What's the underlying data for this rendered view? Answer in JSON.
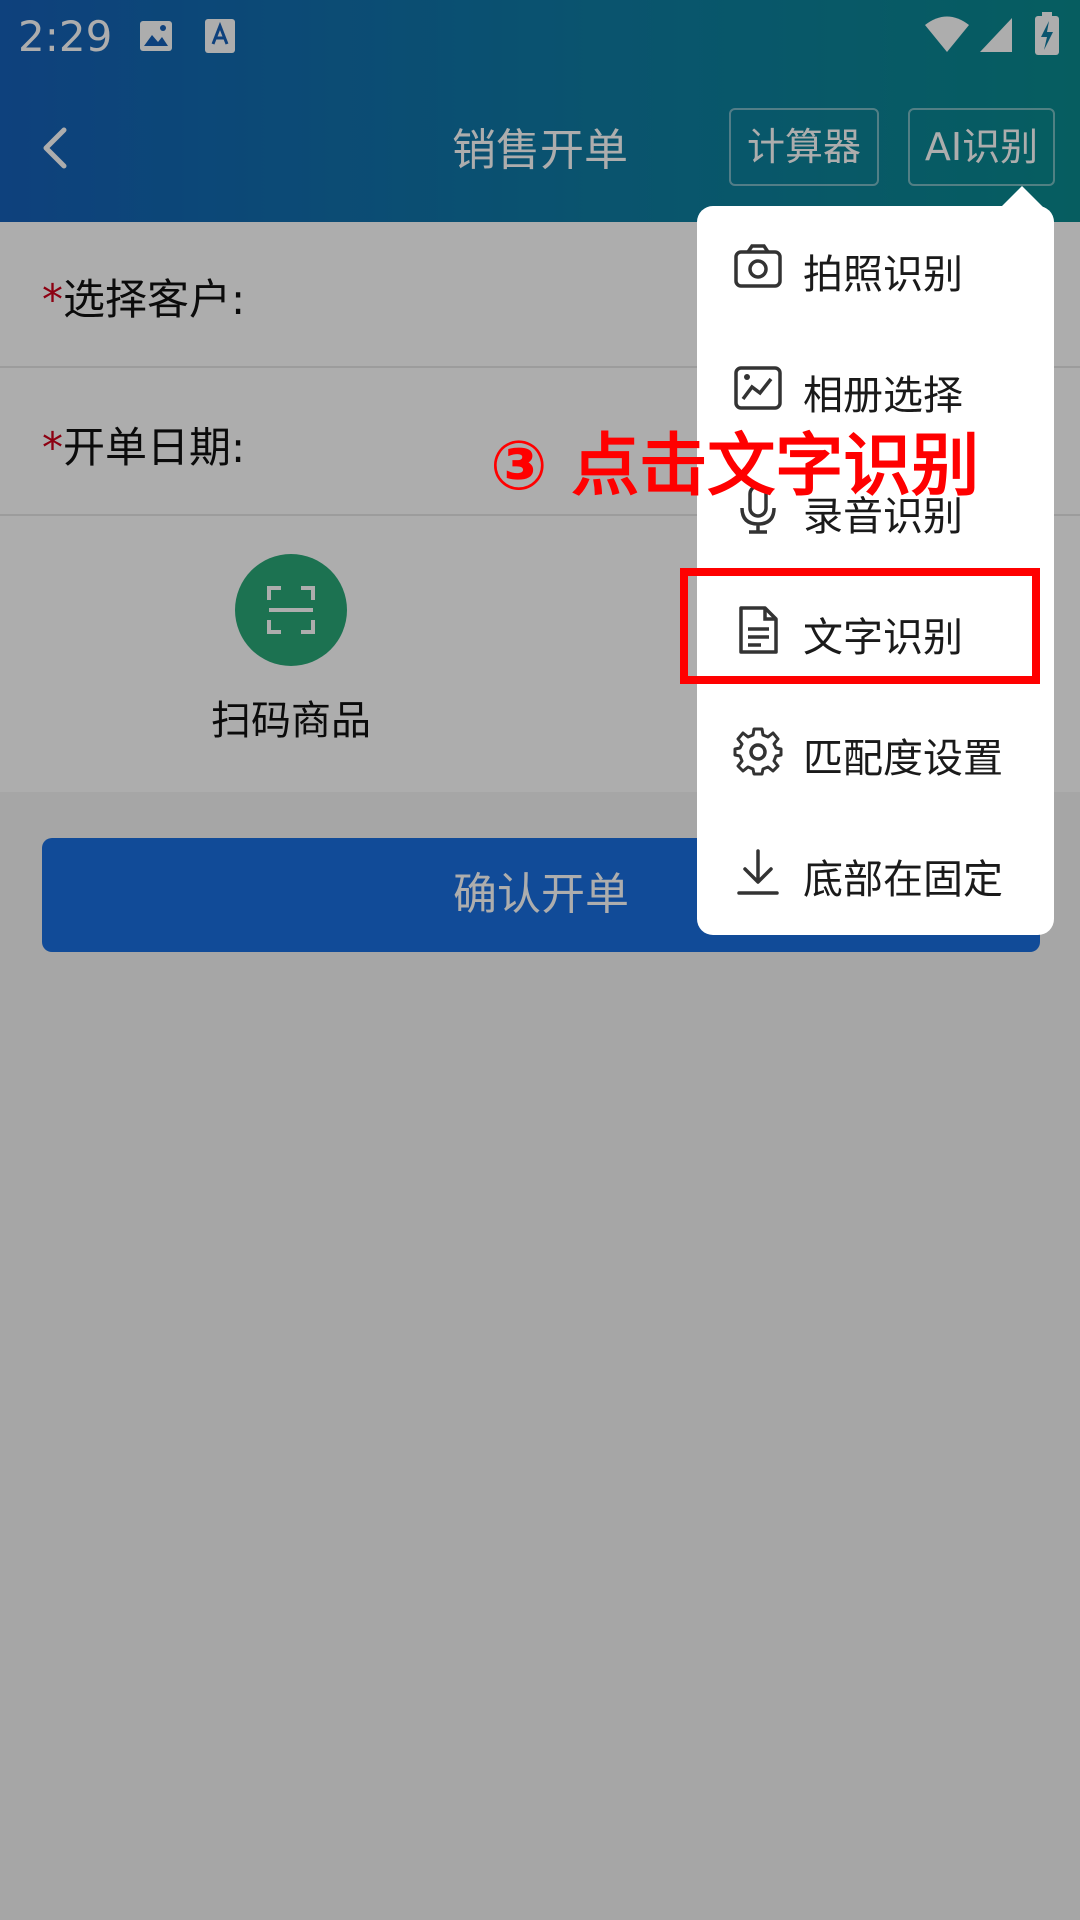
{
  "status_bar": {
    "time": "2:29"
  },
  "titlebar": {
    "title": "销售开单",
    "calculator_label": "计算器",
    "ai_label": "AI识别"
  },
  "form": {
    "customer_label": "选择客户:",
    "date_label": "开单日期:",
    "required_mark": "*"
  },
  "scan": {
    "label": "扫码商品"
  },
  "confirm_label": "确认开单",
  "menu": {
    "items": [
      {
        "label": "拍照识别",
        "icon": "camera-icon"
      },
      {
        "label": "相册选择",
        "icon": "album-icon"
      },
      {
        "label": "录音识别",
        "icon": "microphone-icon"
      },
      {
        "label": "文字识别",
        "icon": "document-icon"
      },
      {
        "label": "匹配度设置",
        "icon": "gear-icon"
      },
      {
        "label": "底部在固定",
        "icon": "download-icon"
      }
    ]
  },
  "annotation": "③ 点击文字识别",
  "colors": {
    "header_start": "#1560b8",
    "header_end": "#098a8e",
    "scan_button": "#2aa878",
    "confirm_button": "#1a6fe0",
    "annotation": "#ff0000"
  }
}
